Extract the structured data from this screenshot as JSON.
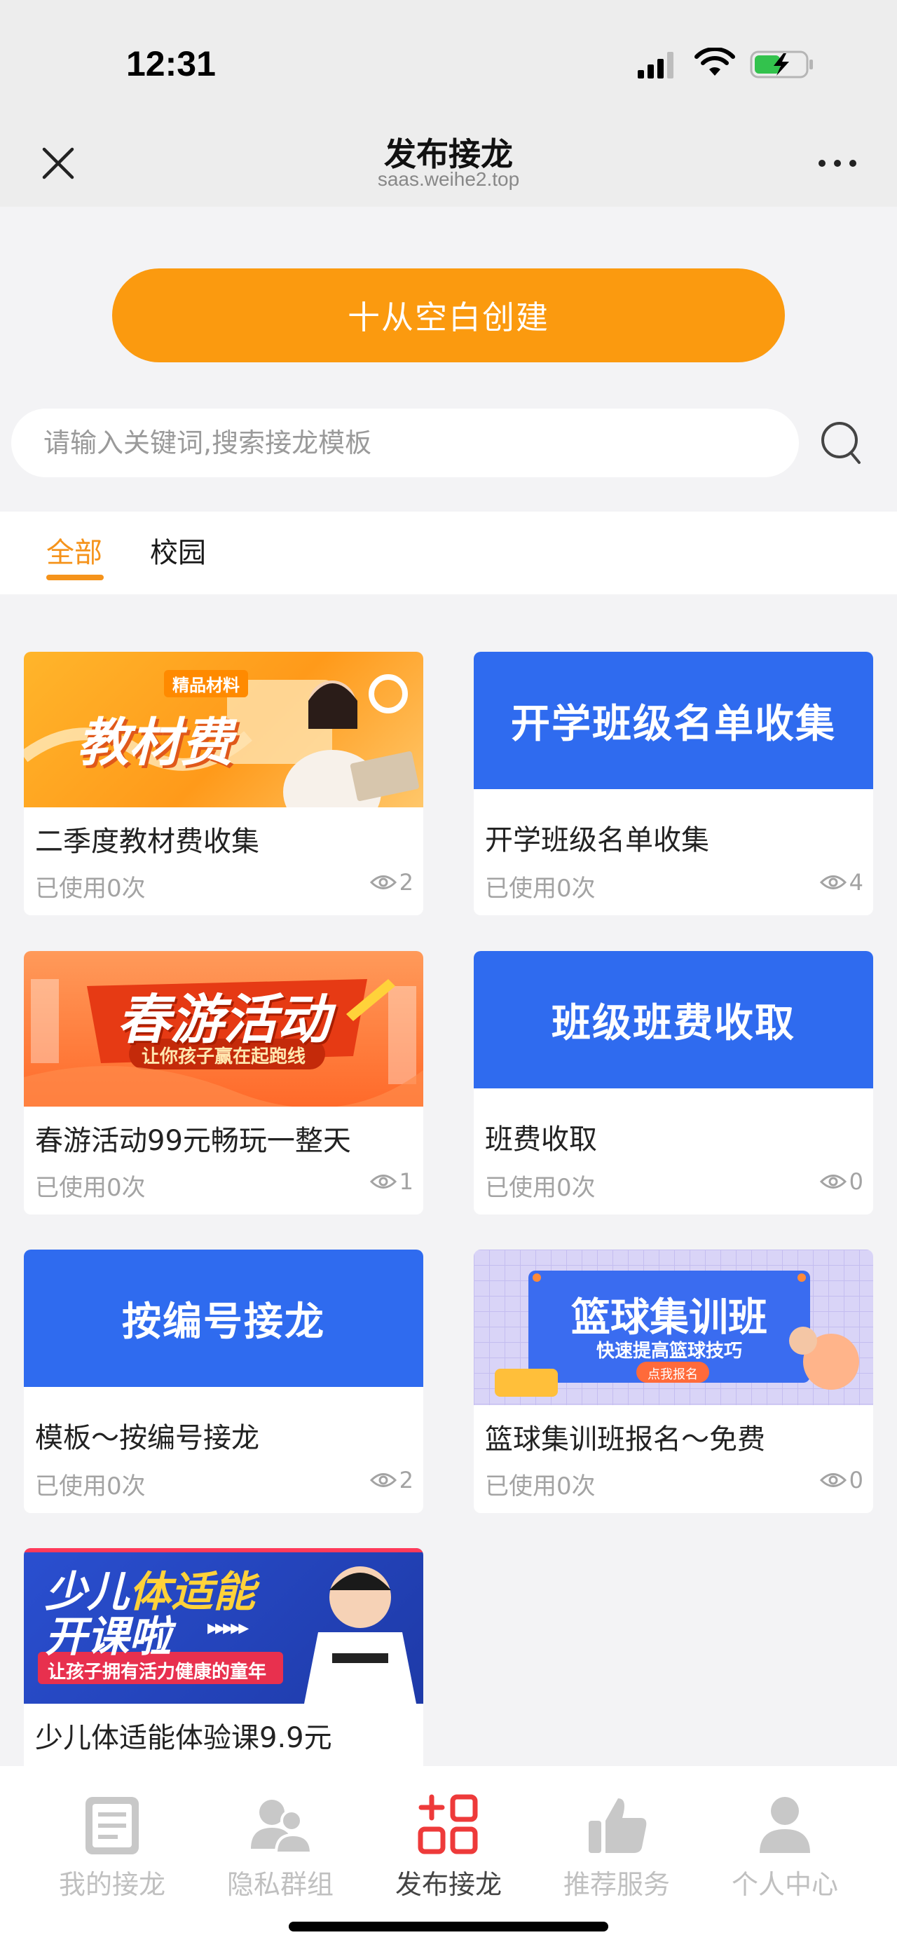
{
  "status": {
    "time": "12:31"
  },
  "nav": {
    "title": "发布接龙",
    "subtitle": "saas.weihe2.top"
  },
  "create_button": "十从空白创建",
  "search": {
    "placeholder": "请输入关键词,搜索接龙模板"
  },
  "tabs": [
    {
      "label": "全部",
      "active": true
    },
    {
      "label": "校园",
      "active": false
    }
  ],
  "cards": [
    {
      "title": "二季度教材费收集",
      "used": "已使用0次",
      "views": "2",
      "banner": {
        "main": "教材费",
        "tag": "精品材料"
      }
    },
    {
      "title": "开学班级名单收集",
      "used": "已使用0次",
      "views": "4",
      "banner": {
        "main": "开学班级名单收集"
      }
    },
    {
      "title": "春游活动99元畅玩一整天",
      "used": "已使用0次",
      "views": "1",
      "banner": {
        "main": "春游活动",
        "sub": "让你孩子赢在起跑线"
      }
    },
    {
      "title": "班费收取",
      "used": "已使用0次",
      "views": "0",
      "banner": {
        "main": "班级班费收取"
      }
    },
    {
      "title": "模板～按编号接龙",
      "used": "已使用0次",
      "views": "2",
      "banner": {
        "main": "按编号接龙"
      }
    },
    {
      "title": "篮球集训班报名～免费",
      "used": "已使用0次",
      "views": "0",
      "banner": {
        "main": "篮球集训班",
        "sub": "快速提高篮球技巧",
        "button": "点我报名"
      }
    },
    {
      "title": "少儿体适能体验课9.9元",
      "banner": {
        "line1a": "少儿",
        "line1b": "体适能",
        "line2": "开课啦",
        "sub": "让孩子拥有活力健康的童年"
      }
    }
  ],
  "tabbar": [
    {
      "label": "我的接龙",
      "icon": "document-icon",
      "active": false
    },
    {
      "label": "隐私群组",
      "icon": "users-icon",
      "active": false
    },
    {
      "label": "发布接龙",
      "icon": "publish-grid-icon",
      "active": true
    },
    {
      "label": "推荐服务",
      "icon": "thumbs-up-icon",
      "active": false
    },
    {
      "label": "个人中心",
      "icon": "person-icon",
      "active": false
    }
  ],
  "colors": {
    "accent": "#fb9a0f",
    "blue_banner": "#2f6bef",
    "active_tab_icon": "#ee3a3a"
  }
}
